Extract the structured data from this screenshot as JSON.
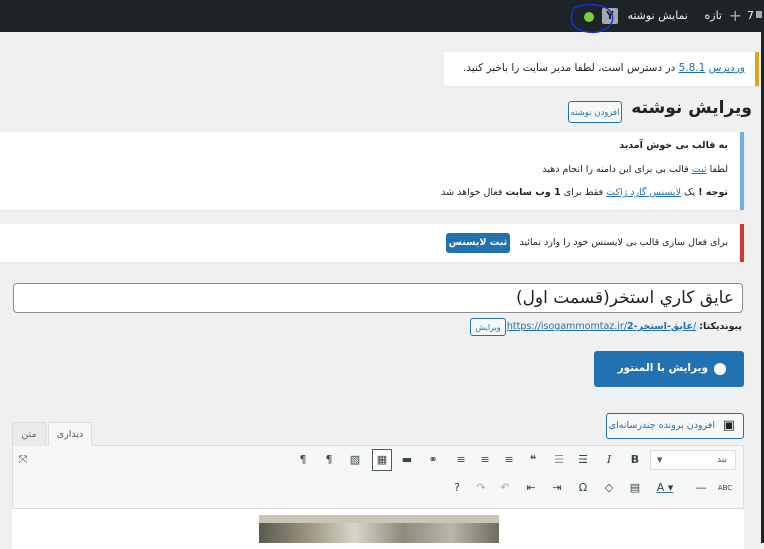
{
  "admin_bar": {
    "comments_count": "7",
    "new_label": "تازه",
    "view_post_label": "نمایش نوشته",
    "yoast_badge": "Y"
  },
  "notices": {
    "update": {
      "prefix": "وردپرس",
      "version_link": "5.8.1",
      "text": "در دسترس است، لطفا مدیر سایت را باخبر کنید."
    },
    "theme": {
      "heading": "به قالب بی خوش آمدید",
      "line2_before": "لطفا",
      "line2_link": "ثبت",
      "line2_after": "قالب بی برای این دامنه را انجام دهید",
      "line3_bold": "توجه !",
      "line3_before": "یک",
      "line3_link": "لایسنس گارد ژاکت",
      "line3_mid": "فقط برای",
      "line3_bold2": "1 وب سایت",
      "line3_after": "فعال خواهد شد"
    },
    "license": {
      "text": "برای فعال سازی قالب بی لایسنس خود را وارد نمائید",
      "button": "ثبت لایسنس"
    }
  },
  "page": {
    "heading": "ویرایش نوشته",
    "add_new": "افزودن نوشته"
  },
  "post": {
    "title": "عايق كاري استخر(قسمت اول)",
    "permalink_label": "پیوندیکتا:",
    "permalink_base": "https://isogammomtaz.ir/",
    "permalink_slug": "عایق-استخر-2",
    "permalink_tail": "/",
    "permalink_edit": "ویرایش"
  },
  "elementor": {
    "button": "ویرایش با المنتور"
  },
  "editor": {
    "add_media": "افزودن پرونده چندرسانه‌ای",
    "tab_visual": "دیداری",
    "tab_text": "متن",
    "format_select": "بند",
    "toolbar_row1_icons": [
      "bold-icon",
      "italic-icon",
      "bullet-list-icon",
      "numbered-list-icon",
      "blockquote-icon",
      "align-right-icon",
      "align-center-icon",
      "align-left-icon",
      "link-icon",
      "read-more-icon",
      "toolbar-toggle-icon",
      "image-icon",
      "rtl-icon",
      "ltr-icon"
    ],
    "toolbar_row2_icons": [
      "strikethrough-icon",
      "horizontal-line-icon",
      "text-color-icon",
      "paste-text-icon",
      "clear-formatting-icon",
      "special-character-icon",
      "outdent-icon",
      "indent-icon",
      "undo-icon",
      "redo-icon",
      "help-icon"
    ]
  }
}
